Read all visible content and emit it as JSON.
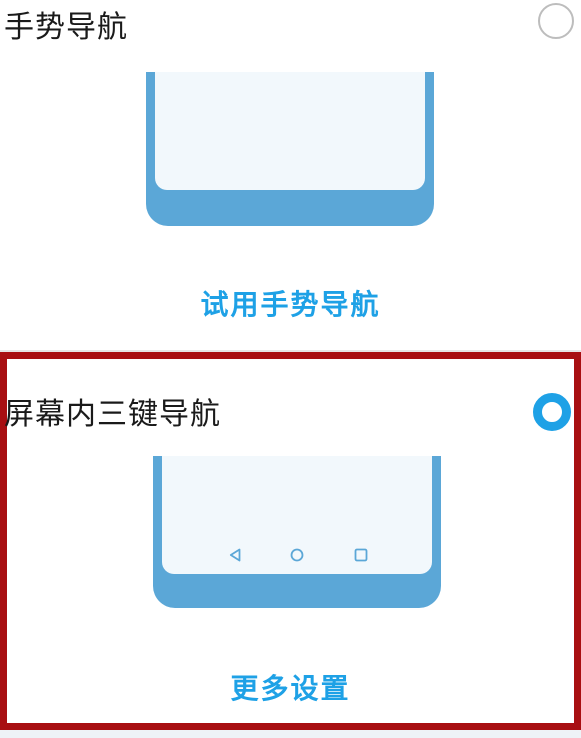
{
  "options": {
    "gesture": {
      "title": "手势导航",
      "selected": false,
      "action_label": "试用手势导航",
      "preview_icon": "phone-gesture-preview"
    },
    "three_key": {
      "title": "屏幕内三键导航",
      "selected": true,
      "action_label": "更多设置",
      "preview_icon": "phone-three-key-preview",
      "nav_keys": [
        "back-triangle-icon",
        "home-circle-icon",
        "recent-square-icon"
      ]
    }
  },
  "colors": {
    "accent": "#1ea1e6",
    "phone_frame": "#5ba7d7",
    "phone_screen": "#f2f8fc",
    "highlight_border": "#a80f12"
  }
}
